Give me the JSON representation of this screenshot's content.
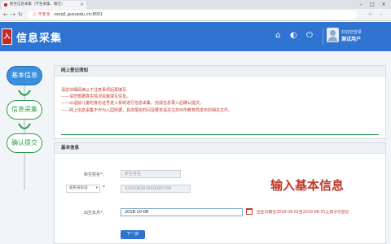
{
  "browser": {
    "tab_title": "新生信息采集（学生采集、随迁）",
    "insecure_label": "不安全",
    "url": "sxxq1.gusuedu.cn:8001"
  },
  "header": {
    "logo_char": "入",
    "title": "信息采集",
    "user_status": "欢迎您登录",
    "user_name": "测试用户"
  },
  "steps": [
    {
      "label": "基本信息"
    },
    {
      "label": "信息采集"
    },
    {
      "label": "确认提交"
    }
  ],
  "notice": {
    "heading": "网上登记须知",
    "lines": [
      "请您详细阅读以下注意事项后再填写",
      "——请您根据真实情况完整填写信息。",
      "——以适龄儿童的身份证号进入系统进行信息采集，完成信息录入后确认提交。",
      "——网上信息采集不作为入园依据，具体报名时间及要求请关注苏州市教育局发布的相关文件。"
    ]
  },
  "basic": {
    "heading": "基本信息",
    "name_label": "新生姓名*：",
    "name_value": "新生姓名",
    "id_type": "居民身份证",
    "id_value": "320508201810080799",
    "birth_label": "出生年月*：",
    "birth_value": "2018-10-08",
    "hint": "出生日期在2018-09-01至2019-08-31之前才可登记",
    "next_button": "下一步",
    "caption": "输入基本信息"
  }
}
